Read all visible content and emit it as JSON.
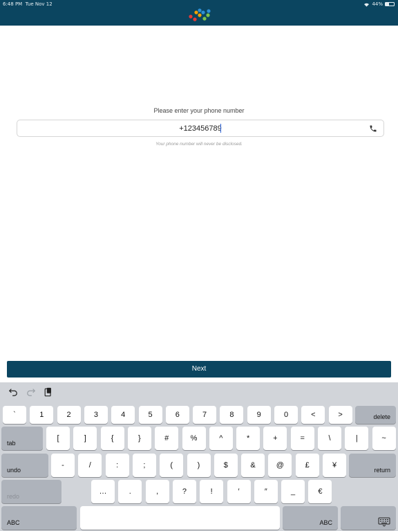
{
  "status_bar": {
    "time": "6:48 PM",
    "date": "Tue Nov 12",
    "battery": "44%",
    "battery_level": 0.44
  },
  "brand": {
    "header_color": "#0b4560",
    "logo_dots": [
      "#e53935",
      "#f4a000",
      "#2c8fd6",
      "#7cc24c"
    ]
  },
  "form": {
    "prompt": "Please enter your phone number",
    "phone_value": "+123456789",
    "disclaimer": "Your phone number will never be disclosed.",
    "field_icon": "phone-icon"
  },
  "next_button": {
    "label": "Next"
  },
  "keyboard": {
    "toolbar_icons": [
      "undo-icon",
      "redo-icon",
      "paste-icon"
    ],
    "rows": [
      [
        "`",
        "1",
        "2",
        "3",
        "4",
        "5",
        "6",
        "7",
        "8",
        "9",
        "0",
        "<",
        ">"
      ],
      [
        "[",
        "]",
        "{",
        "}",
        "#",
        "%",
        "^",
        "*",
        "+",
        "=",
        "\\",
        "|",
        "~"
      ],
      [
        "-",
        "/",
        ":",
        ";",
        "(",
        ")",
        "$",
        "&",
        "@",
        "£",
        "¥"
      ],
      [
        "…",
        ".",
        ",",
        "?",
        "!",
        "′",
        "″",
        "_",
        "€"
      ]
    ],
    "delete_label": "delete",
    "tab_label": "tab",
    "undo_label": "undo",
    "return_label": "return",
    "redo_label": "redo",
    "abc_left_label": "ABC",
    "abc_right_label": "ABC",
    "hide_icon": "keyboard-hide-icon"
  }
}
